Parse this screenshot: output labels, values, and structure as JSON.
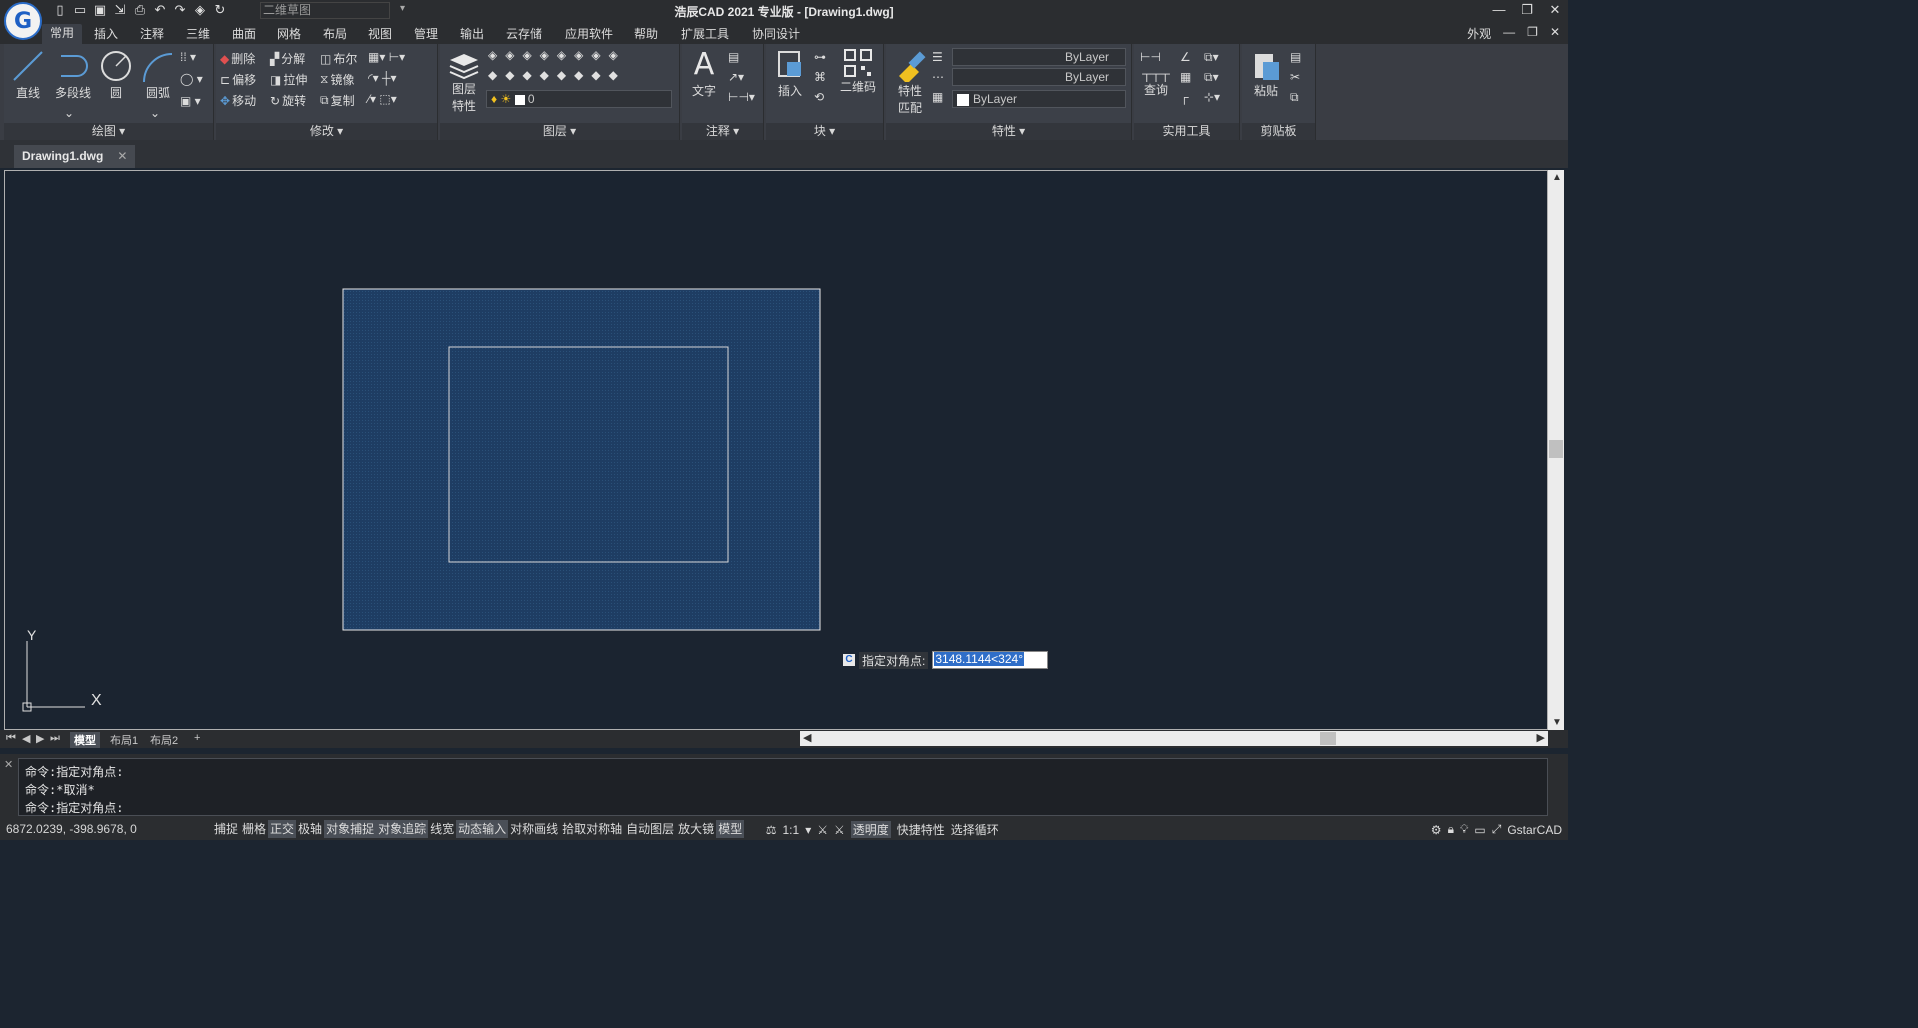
{
  "app": {
    "title": "浩辰CAD 2021 专业版 - [Drawing1.dwg]",
    "logo_letter": "G",
    "workspace": "二维草图",
    "appearance": "外观"
  },
  "tabs": [
    "常用",
    "插入",
    "注释",
    "三维",
    "曲面",
    "网格",
    "布局",
    "视图",
    "管理",
    "输出",
    "云存储",
    "应用软件",
    "帮助",
    "扩展工具",
    "协同设计"
  ],
  "ribbon": {
    "draw": {
      "title": "绘图",
      "line": "直线",
      "polyline": "多段线",
      "circle": "圆",
      "arc": "圆弧"
    },
    "modify": {
      "title": "修改",
      "erase": "删除",
      "explode": "分解",
      "boolean": "布尔",
      "offset": "偏移",
      "stretch": "拉伸",
      "mirror": "镜像",
      "move": "移动",
      "rotate": "旋转",
      "copy": "复制"
    },
    "layers": {
      "title": "图层",
      "props_line1": "图层",
      "props_line2": "特性",
      "current_layer": "0"
    },
    "annotation": {
      "title": "注释",
      "text": "文字"
    },
    "block": {
      "title": "块",
      "insert": "插入",
      "qrcode": "二维码"
    },
    "properties": {
      "title": "特性",
      "match_line1": "特性",
      "match_line2": "匹配",
      "color": "ByLayer",
      "linetype": "ByLayer",
      "lineweight": "ByLayer"
    },
    "utilities": {
      "title": "实用工具",
      "query": "查询"
    },
    "clipboard": {
      "title": "剪贴板",
      "paste": "粘贴"
    }
  },
  "document": {
    "tab": "Drawing1.dwg"
  },
  "canvas": {
    "prompt_label": "指定对角点:",
    "prompt_value": "3148.1144<324°",
    "ucs_y": "Y",
    "ucs_x": "X"
  },
  "layout_tabs": [
    "模型",
    "布局1",
    "布局2",
    "+"
  ],
  "command_history": [
    "命令:指定对角点:",
    "命令:*取消*",
    "命令:指定对角点:"
  ],
  "status": {
    "coords": "6872.0239, -398.9678, 0",
    "items": [
      {
        "label": "捕捉",
        "on": false
      },
      {
        "label": "栅格",
        "on": false
      },
      {
        "label": "正交",
        "on": true
      },
      {
        "label": "极轴",
        "on": false
      },
      {
        "label": "对象捕捉",
        "on": true
      },
      {
        "label": "对象追踪",
        "on": true
      },
      {
        "label": "线宽",
        "on": false
      },
      {
        "label": "动态输入",
        "on": true
      },
      {
        "label": "对称画线",
        "on": false
      },
      {
        "label": "拾取对称轴",
        "on": false
      },
      {
        "label": "自动图层",
        "on": false
      },
      {
        "label": "放大镜",
        "on": false
      },
      {
        "label": "模型",
        "on": true
      }
    ],
    "scale": "1:1",
    "transparency": "透明度",
    "quickprops": "快捷特性",
    "selcycle": "选择循环",
    "brand": "GstarCAD"
  }
}
